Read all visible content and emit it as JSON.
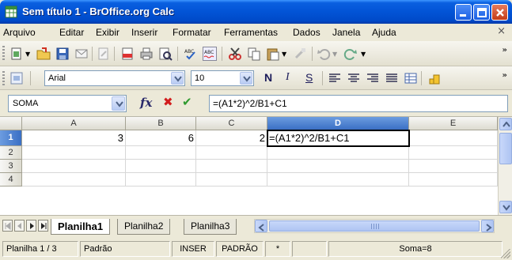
{
  "window": {
    "title": "Sem título 1 - BrOffice.org Calc",
    "accent": "#0054e3"
  },
  "menu": {
    "items": [
      "Arquivo",
      "Editar",
      "Exibir",
      "Inserir",
      "Formatar",
      "Ferramentas",
      "Dados",
      "Janela",
      "Ajuda"
    ],
    "close_doc": "×"
  },
  "toolbar_standard": {
    "icons": [
      "new-document-icon",
      "open-folder-icon",
      "save-icon",
      "email-icon",
      "edit-file-icon",
      "export-pdf-icon",
      "print-icon",
      "page-preview-icon",
      "spellcheck-icon",
      "autospellcheck-icon",
      "cut-icon",
      "copy-icon",
      "paste-icon",
      "format-paintbrush-icon",
      "undo-icon",
      "redo-icon"
    ],
    "spell_label": "ABC",
    "overflow": "»"
  },
  "toolbar_format": {
    "font_name": "Arial",
    "font_size": "10",
    "bold": "N",
    "italic": "I",
    "underline": "S",
    "overflow": "»"
  },
  "formula_bar": {
    "name_box": "SOMA",
    "fx": "fx",
    "cancel": "✖",
    "accept": "✔",
    "formula": "=(A1*2)^2/B1+C1"
  },
  "grid": {
    "columns": [
      "A",
      "B",
      "C",
      "D",
      "E"
    ],
    "active_column": "D",
    "rows": [
      "1",
      "2",
      "3",
      "4"
    ],
    "active_row": "1",
    "cells": {
      "A1": "3",
      "B1": "6",
      "C1": "2",
      "D1": "=(A1*2)^2/B1+C1"
    }
  },
  "sheets": {
    "tabs": [
      "Planilha1",
      "Planilha2",
      "Planilha3"
    ],
    "active": "Planilha1"
  },
  "status": {
    "sheet": "Planilha 1 / 3",
    "style": "Padrão",
    "insert_mode": "INSER",
    "selection_mode": "PADRÃO",
    "modified": "*",
    "sum": "Soma=8"
  }
}
